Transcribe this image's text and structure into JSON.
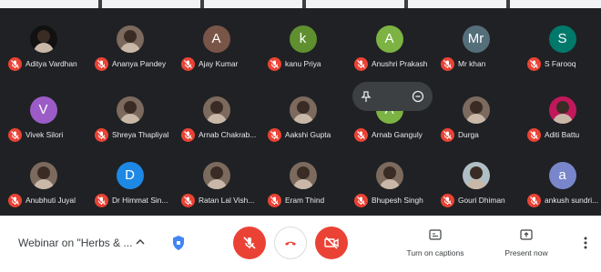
{
  "participants": [
    {
      "name": "Aditya Vardhan",
      "initial": "",
      "color": "#111111",
      "photo": true
    },
    {
      "name": "Ananya Pandey",
      "initial": "",
      "color": "#7b6a5d",
      "photo": true
    },
    {
      "name": "Ajay Kumar",
      "initial": "A",
      "color": "#795548",
      "photo": false
    },
    {
      "name": "kanu Priya",
      "initial": "k",
      "color": "#5f8f2f",
      "photo": false
    },
    {
      "name": "Anushri Prakash",
      "initial": "A",
      "color": "#7cb342",
      "photo": false
    },
    {
      "name": "Mr khan",
      "initial": "Mr",
      "color": "#546e7a",
      "photo": false
    },
    {
      "name": "S Farooq",
      "initial": "S",
      "color": "#00796b",
      "photo": false
    },
    {
      "name": "Vivek Silori",
      "initial": "V",
      "color": "#9c5cc8",
      "photo": false
    },
    {
      "name": "Shreya Thapliyal",
      "initial": "",
      "color": "#7b6a5d",
      "photo": true
    },
    {
      "name": "Arnab Chakrab...",
      "initial": "",
      "color": "#7b6a5d",
      "photo": true
    },
    {
      "name": "Aakshi Gupta",
      "initial": "",
      "color": "#7b6a5d",
      "photo": true
    },
    {
      "name": "Arnab Ganguly",
      "initial": "A",
      "color": "#7cb342",
      "photo": false
    },
    {
      "name": "Durga",
      "initial": "",
      "color": "#7b6a5d",
      "photo": true
    },
    {
      "name": "Aditi Battu",
      "initial": "",
      "color": "#c2185b",
      "photo": true
    },
    {
      "name": "Anubhuti Juyal",
      "initial": "",
      "color": "#7b6a5d",
      "photo": true
    },
    {
      "name": "Dr Himmat Sin...",
      "initial": "D",
      "color": "#1e88e5",
      "photo": false
    },
    {
      "name": "Ratan Lal Vish...",
      "initial": "",
      "color": "#7b6a5d",
      "photo": true
    },
    {
      "name": "Eram Thind",
      "initial": "",
      "color": "#7b6a5d",
      "photo": true
    },
    {
      "name": "Bhupesh Singh",
      "initial": "",
      "color": "#7b6a5d",
      "photo": true
    },
    {
      "name": "Gouri Dhiman",
      "initial": "",
      "color": "#b0bec5",
      "photo": true
    },
    {
      "name": "ankush sundri...",
      "initial": "a",
      "color": "#7986cb",
      "photo": false
    }
  ],
  "bottom_bar": {
    "meeting_title": "Webinar on \"Herbs & ...",
    "captions_label": "Turn on captions",
    "present_label": "Present now"
  },
  "colors": {
    "mute_red": "#ea4335",
    "background": "#202124"
  }
}
